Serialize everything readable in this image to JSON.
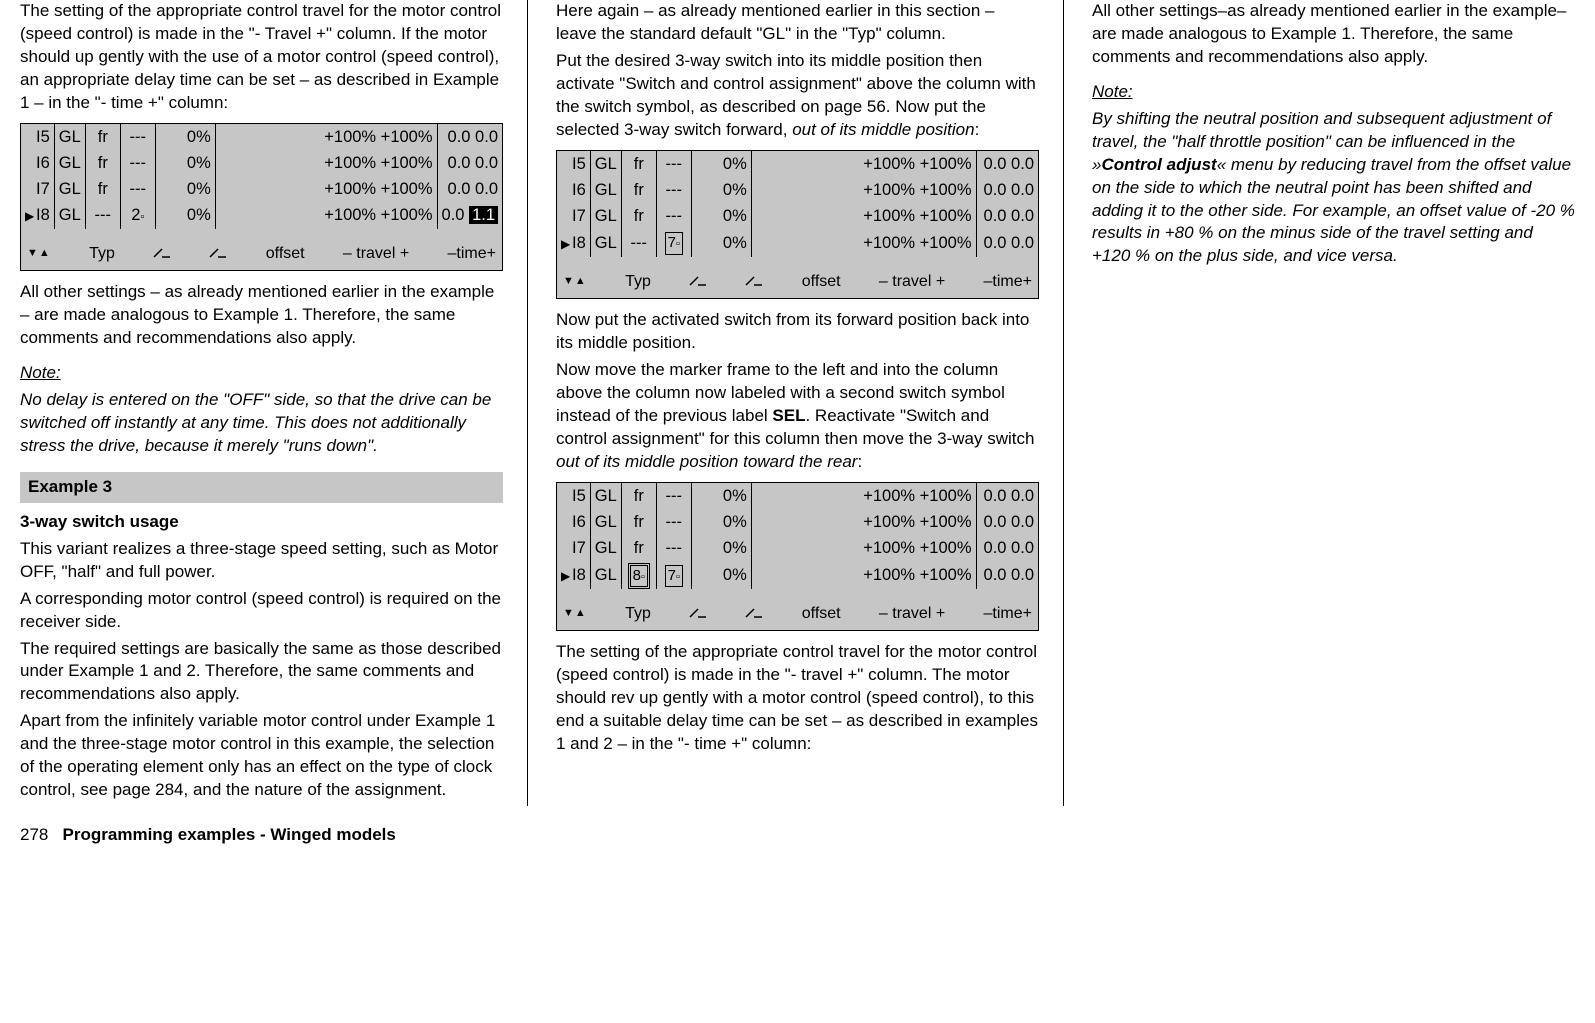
{
  "col1": {
    "p1": "The setting of the appropriate control travel for the motor control (speed control) is made in the \"- Travel +\" column. If the motor should up gently with the use of a motor control (speed control), an appropriate delay time can be set – as described in Example 1 – in the \"- time +\" column:",
    "table1": {
      "rows": [
        {
          "sel": "",
          "ch": "I5",
          "typ": "GL",
          "sw1": "fr",
          "sw2": "---",
          "off": "0%",
          "tn": "+100%",
          "tp": "+100%",
          "t1": "0.0",
          "t2": "0.0"
        },
        {
          "sel": "",
          "ch": "I6",
          "typ": "GL",
          "sw1": "fr",
          "sw2": "---",
          "off": "0%",
          "tn": "+100%",
          "tp": "+100%",
          "t1": "0.0",
          "t2": "0.0"
        },
        {
          "sel": "",
          "ch": "I7",
          "typ": "GL",
          "sw1": "fr",
          "sw2": "---",
          "off": "0%",
          "tn": "+100%",
          "tp": "+100%",
          "t1": "0.0",
          "t2": "0.0"
        },
        {
          "sel": "▶",
          "ch": "I8",
          "typ": "GL",
          "sw1": "---",
          "sw2": "2",
          "off": "0%",
          "tn": "+100%",
          "tp": "+100%",
          "t1": "0.0",
          "t2": "1.1",
          "hl_t2": true
        }
      ],
      "footer": {
        "c1": "▼▲",
        "c2": "Typ",
        "c3a": "⸌⸍",
        "c3b": "⸌⸍",
        "c4": "offset",
        "c5": "– travel +",
        "c6": "–time+"
      }
    },
    "p2": "All other settings – as already mentioned earlier in the example – are made analogous to Example 1. Therefore, the same comments and recommendations also apply.",
    "note_label": "Note:",
    "note_body": "No delay is entered on the \"OFF\" side, so that the drive can be switched off instantly at any time. This does not additionally stress the drive, because it merely \"runs down\".",
    "ex3_header": "Example 3",
    "ex3_sub": "3-way switch usage",
    "ex3_p1": "This variant realizes a three-stage speed setting, such as Motor OFF, \"half\" and full power.",
    "ex3_p2": "A corresponding motor control (speed control) is required on the receiver side.",
    "ex3_p3": "The required settings are basically the same as those described under Example 1 and 2. Therefore, the same comments and recommendations also apply.",
    "ex3_p4": "Apart from the infinitely variable motor control under Example 1 and the three-stage motor control in this example, the selection of the operating element only has an effect on the type of clock control, see page 284, and the nature of the assignment."
  },
  "col2": {
    "p1": "Here again – as already mentioned earlier in this section – leave the standard default \"GL\" in the \"Typ\" column.",
    "p2_a": "Put the desired 3-way switch into its middle position then activate \"Switch and control assignment\" above the column with the switch symbol, as described on page 56. Now put the selected 3-way switch forward, ",
    "p2_b": "out of its middle position",
    "p2_c": ":",
    "table2": {
      "rows": [
        {
          "sel": "",
          "ch": "I5",
          "typ": "GL",
          "sw1": "fr",
          "sw2": "---",
          "off": "0%",
          "tn": "+100%",
          "tp": "+100%",
          "t1": "0.0",
          "t2": "0.0"
        },
        {
          "sel": "",
          "ch": "I6",
          "typ": "GL",
          "sw1": "fr",
          "sw2": "---",
          "off": "0%",
          "tn": "+100%",
          "tp": "+100%",
          "t1": "0.0",
          "t2": "0.0"
        },
        {
          "sel": "",
          "ch": "I7",
          "typ": "GL",
          "sw1": "fr",
          "sw2": "---",
          "off": "0%",
          "tn": "+100%",
          "tp": "+100%",
          "t1": "0.0",
          "t2": "0.0"
        },
        {
          "sel": "▶",
          "ch": "I8",
          "typ": "GL",
          "sw1": "---",
          "sw2": "7",
          "sw2_box": true,
          "off": "0%",
          "tn": "+100%",
          "tp": "+100%",
          "t1": "0.0",
          "t2": "0.0"
        }
      ],
      "footer": {
        "c1": "▼▲",
        "c2": "Typ",
        "c3a": "⸌⸍",
        "c3b": "⸌⸍",
        "c4": "offset",
        "c5": "– travel +",
        "c6": "–time+"
      }
    },
    "p3": "Now put the activated switch from its forward position back into its middle position.",
    "p4_a": "Now move the marker frame to the left and into the column above the column now labeled with a second switch symbol instead of the previous label ",
    "p4_sel": "SEL",
    "p4_b": ". Reactivate \"Switch and control assignment\" for this column then move the 3-way switch ",
    "p4_c": "out of its middle position toward the rear",
    "p4_d": ":",
    "table3": {
      "rows": [
        {
          "sel": "",
          "ch": "I5",
          "typ": "GL",
          "sw1": "fr",
          "sw2": "---",
          "off": "0%",
          "tn": "+100%",
          "tp": "+100%",
          "t1": "0.0",
          "t2": "0.0"
        },
        {
          "sel": "",
          "ch": "I6",
          "typ": "GL",
          "sw1": "fr",
          "sw2": "---",
          "off": "0%",
          "tn": "+100%",
          "tp": "+100%",
          "t1": "0.0",
          "t2": "0.0"
        },
        {
          "sel": "",
          "ch": "I7",
          "typ": "GL",
          "sw1": "fr",
          "sw2": "---",
          "off": "0%",
          "tn": "+100%",
          "tp": "+100%",
          "t1": "0.0",
          "t2": "0.0"
        },
        {
          "sel": "▶",
          "ch": "I8",
          "typ": "GL",
          "sw1": "8",
          "sw2": "7",
          "sw1_box": true,
          "sw2_box": true,
          "sw1_dbl": true,
          "off": "0%",
          "tn": "+100%",
          "tp": "+100%",
          "t1": "0.0",
          "t2": "0.0"
        }
      ],
      "footer": {
        "c1": "▼▲",
        "c2": "Typ",
        "c3a": "⸌⸍",
        "c3b": "⸌⸍",
        "c4": "offset",
        "c5": "– travel +",
        "c6": "–time+"
      }
    },
    "p5": "The setting of the appropriate control travel for the motor control (speed control) is made in the \"- travel +\" column. The motor should rev up gently with a motor control (speed control), to this end a suitable delay time can be set – as described in examples 1 and 2 – in the \"- time +\" column:"
  },
  "col3": {
    "p1": "All other settings–as already mentioned earlier in the example–are made analogous to Example 1. Therefore, the same comments and recommendations also apply.",
    "note_label": "Note:",
    "note_a": "By shifting the neutral position and subsequent adjustment of travel, the \"half throttle position\" can be influenced in the »",
    "note_menu": "Control adjust",
    "note_b": "« menu by reducing travel from the offset value on the side to which the neutral point has been shifted and adding it to the other side. For example, an offset value of -20 % results in +80 % on the minus side of the travel setting and +120 % on the plus side, and vice versa."
  },
  "page": {
    "num": "278",
    "title": "Programming examples - Winged models"
  }
}
